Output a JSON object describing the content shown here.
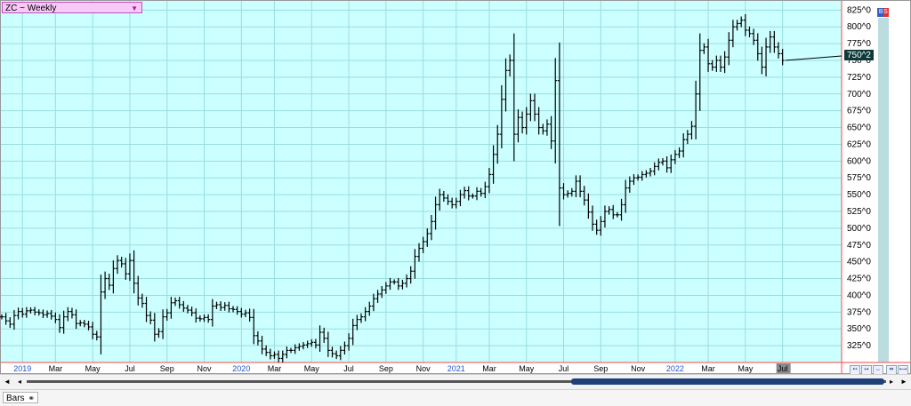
{
  "window": {
    "symbol_label": "ZC ~ Weekly",
    "badge_left": "B",
    "badge_right": "S"
  },
  "footer": {
    "tab_label": "Bars",
    "tab_icon": "glasses-icon"
  },
  "colors": {
    "plot_background": "#ccffff",
    "grid": "#99dddd",
    "bars": "#000000",
    "axis_border": "#ff4444",
    "price_tag_bg": "#0f3a3a",
    "price_tag_fg": "#ffffff",
    "highlight_month_bg": "#8a8a8a"
  },
  "chart_data": {
    "type": "ohlc",
    "interval": "weekly",
    "ylim": [
      300,
      840
    ],
    "y_ticks": [
      "325^0",
      "350^0",
      "375^0",
      "400^0",
      "425^0",
      "450^0",
      "475^0",
      "500^0",
      "525^0",
      "550^0",
      "575^0",
      "600^0",
      "625^0",
      "650^0",
      "675^0",
      "700^0",
      "725^0",
      "750^0",
      "775^0",
      "800^0",
      "825^0"
    ],
    "y_tick_values": [
      325,
      350,
      375,
      400,
      425,
      450,
      475,
      500,
      525,
      550,
      575,
      600,
      625,
      650,
      675,
      700,
      725,
      750,
      775,
      800,
      825
    ],
    "x_range_weeks": [
      0,
      202
    ],
    "x_ticks": [
      {
        "label": "2019",
        "week": 5,
        "year": true
      },
      {
        "label": "Mar",
        "week": 13
      },
      {
        "label": "May",
        "week": 22
      },
      {
        "label": "Jul",
        "week": 31
      },
      {
        "label": "Sep",
        "week": 40
      },
      {
        "label": "Nov",
        "week": 49
      },
      {
        "label": "2020",
        "week": 58,
        "year": true
      },
      {
        "label": "Mar",
        "week": 66
      },
      {
        "label": "May",
        "week": 75
      },
      {
        "label": "Jul",
        "week": 84
      },
      {
        "label": "Sep",
        "week": 93
      },
      {
        "label": "Nov",
        "week": 102
      },
      {
        "label": "2021",
        "week": 110,
        "year": true
      },
      {
        "label": "Mar",
        "week": 118
      },
      {
        "label": "May",
        "week": 127
      },
      {
        "label": "Jul",
        "week": 136
      },
      {
        "label": "Sep",
        "week": 145
      },
      {
        "label": "Nov",
        "week": 154
      },
      {
        "label": "2022",
        "week": 163,
        "year": true
      },
      {
        "label": "Mar",
        "week": 171
      },
      {
        "label": "May",
        "week": 180
      },
      {
        "label": "Jul",
        "week": 189,
        "highlight": true
      }
    ],
    "current_price_label": "750^2",
    "current_price": 750,
    "closes": [
      368,
      362,
      357,
      370,
      376,
      372,
      377,
      378,
      375,
      374,
      371,
      373,
      369,
      364,
      352,
      368,
      376,
      371,
      358,
      359,
      357,
      353,
      342,
      338,
      405,
      425,
      415,
      440,
      452,
      447,
      432,
      452,
      418,
      396,
      388,
      370,
      363,
      342,
      346,
      368,
      374,
      389,
      392,
      386,
      381,
      378,
      374,
      366,
      365,
      367,
      364,
      384,
      386,
      382,
      385,
      380,
      379,
      376,
      372,
      374,
      367,
      340,
      332,
      320,
      315,
      310,
      312,
      306,
      312,
      318,
      318,
      322,
      324,
      326,
      328,
      330,
      326,
      345,
      336,
      318,
      313,
      310,
      318,
      325,
      336,
      355,
      364,
      368,
      376,
      384,
      395,
      402,
      408,
      414,
      420,
      420,
      414,
      418,
      425,
      436,
      458,
      470,
      480,
      492,
      510,
      535,
      550,
      545,
      540,
      535,
      540,
      550,
      556,
      548,
      548,
      555,
      552,
      562,
      580,
      610,
      640,
      692,
      735,
      750,
      640,
      665,
      650,
      670,
      690,
      670,
      650,
      645,
      655,
      630,
      720,
      560,
      550,
      552,
      555,
      570,
      555,
      542,
      524,
      506,
      497,
      510,
      525,
      528,
      520,
      520,
      535,
      560,
      570,
      575,
      576,
      580,
      582,
      585,
      592,
      598,
      600,
      590,
      602,
      610,
      615,
      632,
      640,
      652,
      700,
      765,
      770,
      745,
      740,
      750,
      740,
      755,
      780,
      800,
      805,
      810,
      795,
      790,
      780,
      760,
      740,
      770,
      785,
      770,
      760,
      750
    ]
  }
}
